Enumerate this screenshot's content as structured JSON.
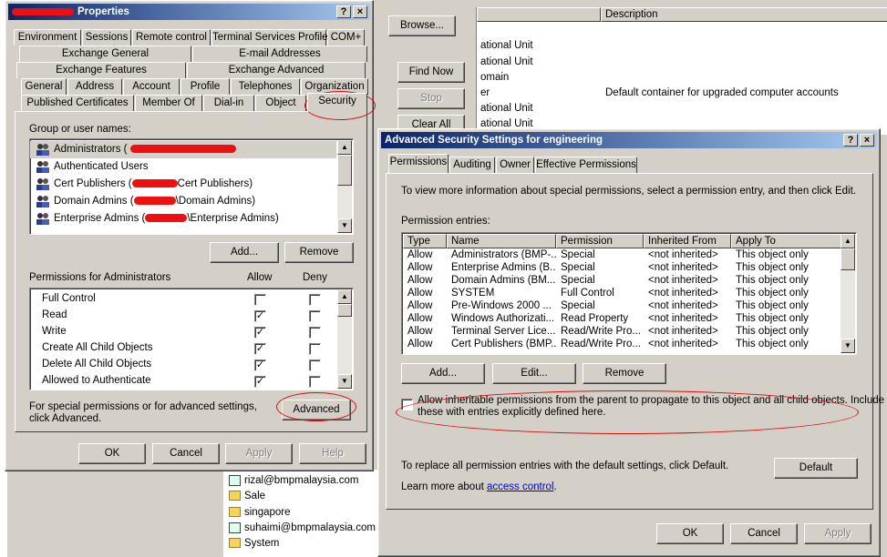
{
  "background": {
    "top_buttons": {
      "browse": "Browse...",
      "find_now": "Find Now",
      "stop": "Stop",
      "clear_all": "Clear All"
    },
    "list_header_description": "Description",
    "list_rows": [
      {
        "name": "ational Unit",
        "description": ""
      },
      {
        "name": "ational Unit",
        "description": ""
      },
      {
        "name": "omain",
        "description": ""
      },
      {
        "name": "er",
        "description": "Default container for upgraded computer accounts"
      },
      {
        "name": "ational Unit",
        "description": ""
      },
      {
        "name": "ational Unit",
        "description": ""
      }
    ],
    "bottom_list": [
      "rizal@bmpmalaysia.com",
      "Sale",
      "singapore",
      "suhaimi@bmpmalaysia.com",
      "System"
    ]
  },
  "properties": {
    "title": "Properties",
    "tabs_row1": [
      "Environment",
      "Sessions",
      "Remote control",
      "Terminal Services Profile",
      "COM+"
    ],
    "tabs_row2": [
      "Exchange General",
      "E-mail Addresses"
    ],
    "tabs_row3": [
      "Exchange Features",
      "Exchange Advanced"
    ],
    "tabs_row4": [
      "General",
      "Address",
      "Account",
      "Profile",
      "Telephones",
      "Organization"
    ],
    "tabs_row5": [
      "Published Certificates",
      "Member Of",
      "Dial-in",
      "Object",
      "Security"
    ],
    "group_label": "Group or user names:",
    "users": [
      "Administrators (",
      "Authenticated Users",
      "Cert Publishers (",
      "Domain Admins (",
      "Enterprise Admins ("
    ],
    "user_suffixes": [
      "",
      "",
      "Cert Publishers)",
      "\\Domain Admins)",
      "\\Enterprise Admins)"
    ],
    "add_button": "Add...",
    "remove_button": "Remove",
    "perm_label": "Permissions for Administrators",
    "allow_label": "Allow",
    "deny_label": "Deny",
    "permissions": [
      {
        "name": "Full Control",
        "allow": false,
        "deny": false
      },
      {
        "name": "Read",
        "allow": true,
        "deny": false
      },
      {
        "name": "Write",
        "allow": true,
        "deny": false
      },
      {
        "name": "Create All Child Objects",
        "allow": true,
        "deny": false
      },
      {
        "name": "Delete All Child Objects",
        "allow": true,
        "deny": false
      },
      {
        "name": "Allowed to Authenticate",
        "allow": true,
        "deny": false
      }
    ],
    "special_text_1": "For special permissions or for advanced settings,",
    "special_text_2": "click Advanced.",
    "advanced_button": "Advanced",
    "ok_button": "OK",
    "cancel_button": "Cancel",
    "apply_button": "Apply",
    "help_button": "Help",
    "check_glyph": "✓"
  },
  "advanced": {
    "title": "Advanced Security Settings for engineering",
    "help_glyph": "?",
    "close_glyph": "×",
    "tabs": [
      "Permissions",
      "Auditing",
      "Owner",
      "Effective Permissions"
    ],
    "info_text": "To view more information about special permissions, select a permission entry, and then click Edit.",
    "entries_label": "Permission entries:",
    "columns": [
      "Type",
      "Name",
      "Permission",
      "Inherited From",
      "Apply To"
    ],
    "entries": [
      {
        "type": "Allow",
        "name": "Administrators (BMP-...",
        "permission": "Special",
        "inherited": "<not inherited>",
        "apply": "This object only"
      },
      {
        "type": "Allow",
        "name": "Enterprise Admins (B...",
        "permission": "Special",
        "inherited": "<not inherited>",
        "apply": "This object only"
      },
      {
        "type": "Allow",
        "name": "Domain Admins (BM...",
        "permission": "Special",
        "inherited": "<not inherited>",
        "apply": "This object only"
      },
      {
        "type": "Allow",
        "name": "SYSTEM",
        "permission": "Full Control",
        "inherited": "<not inherited>",
        "apply": "This object only"
      },
      {
        "type": "Allow",
        "name": "Pre-Windows 2000 ...",
        "permission": "Special",
        "inherited": "<not inherited>",
        "apply": "This object only"
      },
      {
        "type": "Allow",
        "name": "Windows Authorizati...",
        "permission": "Read Property",
        "inherited": "<not inherited>",
        "apply": "This object only"
      },
      {
        "type": "Allow",
        "name": "Terminal Server Lice...",
        "permission": "Read/Write Pro...",
        "inherited": "<not inherited>",
        "apply": "This object only"
      },
      {
        "type": "Allow",
        "name": "Cert Publishers (BMP...",
        "permission": "Read/Write Pro...",
        "inherited": "<not inherited>",
        "apply": "This object only"
      }
    ],
    "add_button": "Add...",
    "edit_button": "Edit...",
    "remove_button": "Remove",
    "inherit_text_1": "Allow inheritable permissions from the parent to propagate to this object and all child objects. Include",
    "inherit_text_2": "these with entries explicitly defined here.",
    "default_text": "To replace all permission entries with the default settings, click Default.",
    "default_button": "Default",
    "learn_more": "Learn more about",
    "learn_link": "access control",
    "learn_period": ".",
    "ok_button": "OK",
    "cancel_button": "Cancel",
    "apply_button": "Apply"
  },
  "colors": {
    "annotation_red": "#d21010",
    "title_blue": "#0a246a",
    "face": "#d4d0c8"
  }
}
